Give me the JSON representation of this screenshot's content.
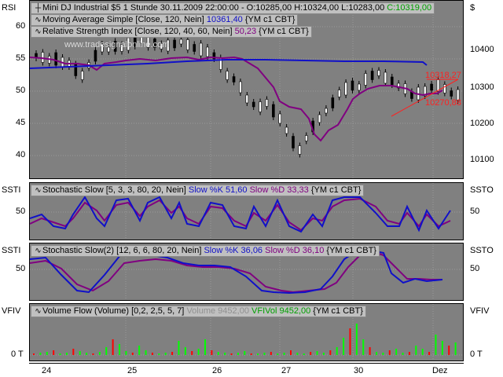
{
  "main": {
    "y_left_label": "RSI",
    "y_right_label": "$",
    "left_ticks": [
      "60",
      "55",
      "50",
      "45",
      "40"
    ],
    "right_ticks": [
      "10400",
      "10300",
      "10200",
      "10100"
    ],
    "title_line": {
      "prefix": "Mini DJ Industrial $5 1 Stunde  30.11.2009 22:00:00 - O:10285,00 H:10324,00 L:10283,00 ",
      "close": "C:10319,00"
    },
    "ma_line": {
      "text": "Moving Average Simple [Close, 120, Nein] ",
      "value": "10361,40",
      "suffix": " {YM c1 CBT}"
    },
    "rsi_line": {
      "text": "Relative Strength Index [Close, 120, 40, 60, Nein] ",
      "value": "50,23",
      "suffix": " {YM c1 CBT}"
    },
    "watermark": "www.tradesignalonline.com",
    "annotation_high": "10318,27",
    "annotation_low": "10270,88"
  },
  "ss1": {
    "left_label": "SSTI",
    "right_label": "SSTO",
    "tick": "50",
    "text": "Stochastic Slow [5, 3, 3, 80, 20, Nein] ",
    "k_label": "Slow %K 51,60",
    "d_label": "Slow %D 33,33",
    "suffix": " {YM c1 CBT}"
  },
  "ss2": {
    "left_label": "SSTI",
    "right_label": "SSTO",
    "tick": "50",
    "text": "Stochastic Slow(2) [12, 6, 6, 80, 20, Nein] ",
    "k_label": "Slow %K 36,06",
    "d_label": "Slow %D 36,10",
    "suffix": " {YM c1 CBT}"
  },
  "vf": {
    "left_label": "VFIV",
    "right_label": "VFIV",
    "tick": "0 T",
    "text": "Volume Flow (Volume) [0,2, 2,5, 5, 7] ",
    "vol_label": "Volume 9452,00",
    "vfi_label": "VFIVol 9452,00",
    "suffix": " {YM c1 CBT}"
  },
  "x_labels": [
    "24",
    "25",
    "26",
    "27",
    "30",
    "Dez"
  ],
  "colors": {
    "panel": "#808080",
    "blue": "#1010c8",
    "purple": "#800080",
    "green": "#00ff00",
    "red": "#ff0000"
  }
}
